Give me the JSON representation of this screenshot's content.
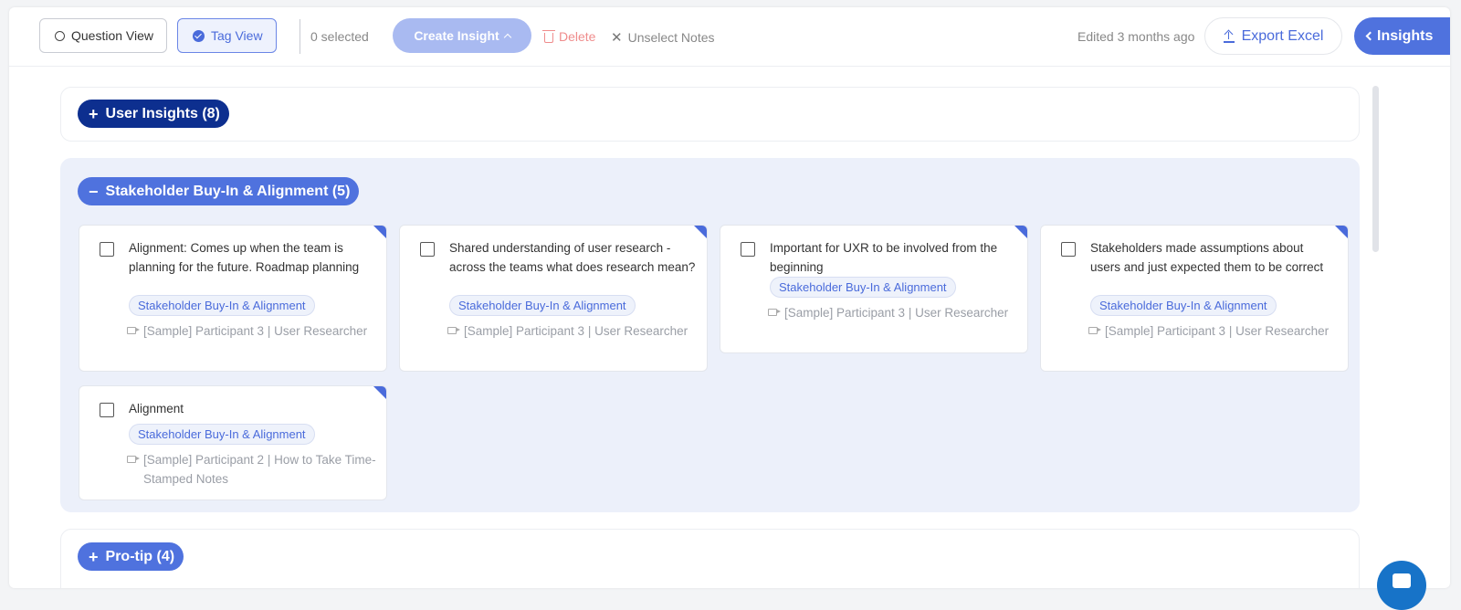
{
  "toolbar": {
    "question_view": "Question View",
    "tag_view": "Tag View",
    "selected_count": "0 selected",
    "create_insight": "Create Insight",
    "delete": "Delete",
    "unselect_notes": "Unselect Notes",
    "edited": "Edited 3 months ago",
    "export_excel": "Export Excel",
    "insights": "Insights"
  },
  "groups": [
    {
      "label": "User Insights (8)",
      "sign": "+",
      "expanded": false
    },
    {
      "label": "Stakeholder Buy-In & Alignment (5)",
      "sign": "−",
      "expanded": true
    },
    {
      "label": "Pro-tip (4)",
      "sign": "+",
      "expanded": false
    }
  ],
  "cards": [
    {
      "text": "Alignment: Comes up when the team is planning for the future. Roadmap planning",
      "tag": "Stakeholder Buy-In & Alignment",
      "source": "[Sample] Participant 3 | User Researcher"
    },
    {
      "text": "Shared understanding of user research - across the teams what does research mean?",
      "tag": "Stakeholder Buy-In & Alignment",
      "source": "[Sample] Participant 3 | User Researcher"
    },
    {
      "text": "Important for UXR to be involved from the beginning",
      "tag": "Stakeholder Buy-In & Alignment",
      "source": "[Sample] Participant 3 | User Researcher"
    },
    {
      "text": "Stakeholders made assumptions about users and just expected them to be correct",
      "tag": "Stakeholder Buy-In & Alignment",
      "source": "[Sample] Participant 3 | User Researcher"
    },
    {
      "text": "Alignment",
      "tag": "Stakeholder Buy-In & Alignment",
      "source": "[Sample] Participant 2 | How to Take Time-Stamped Notes"
    }
  ],
  "colors": {
    "accent": "#4f72de",
    "accent_dark": "#0d2f8f",
    "expanded_bg": "#ecf0fa",
    "delete": "#ef8c8c"
  },
  "icons": [
    "circle-icon",
    "check-circle-icon",
    "chevron-up-icon",
    "trash-icon",
    "close-icon",
    "upload-icon",
    "chevron-left-icon",
    "plus-icon",
    "minus-icon",
    "video-icon",
    "chat-icon"
  ]
}
